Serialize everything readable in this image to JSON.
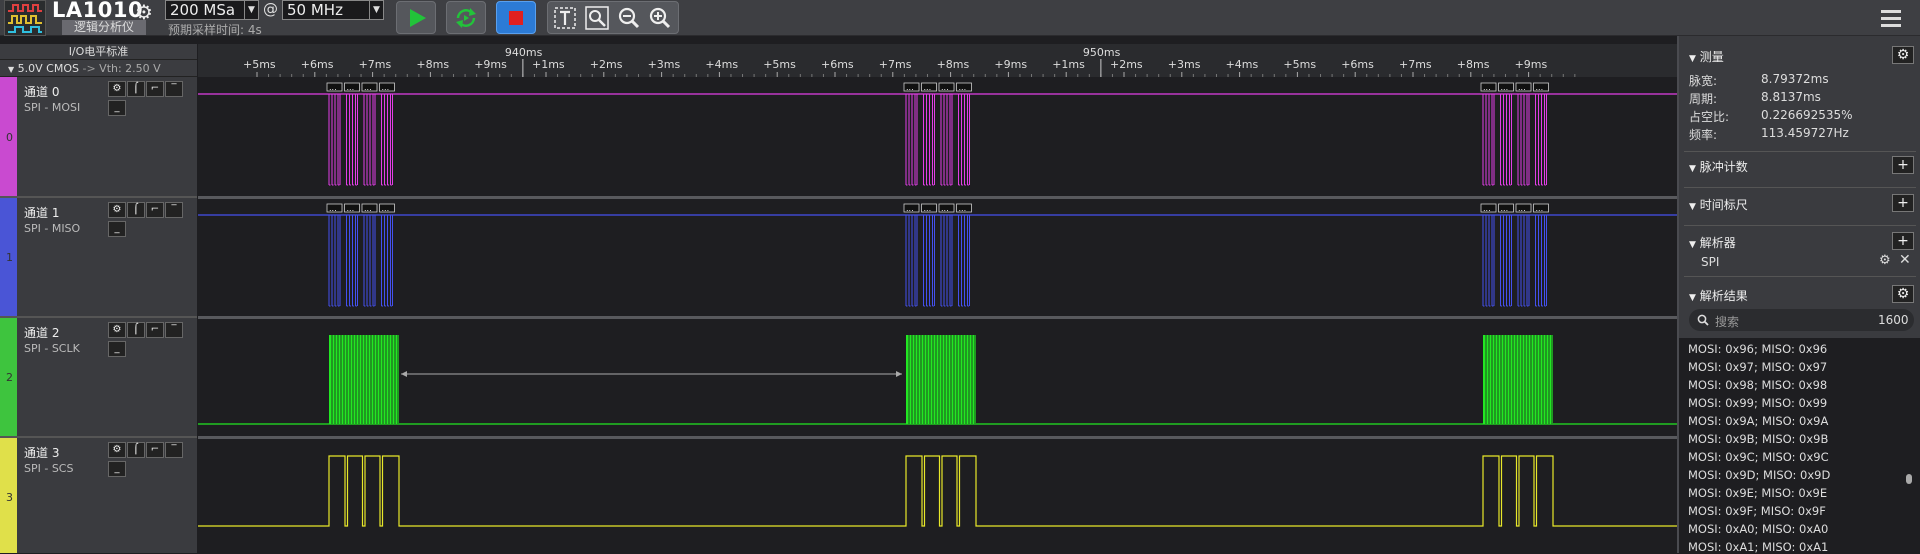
{
  "app": {
    "title": "LA1010",
    "subtitle": "逻辑分析仪",
    "sample_rate": "200 MSa",
    "at": "@",
    "frequency": "50 MHz",
    "sample_time": "预期采样时间: 4s"
  },
  "io": {
    "header": "I/O电平标准",
    "standard": "5.0V CMOS",
    "arrow": "->",
    "vth": "Vth: 2.50 V"
  },
  "channels": [
    {
      "num": "0",
      "name": "通道 0",
      "sub": "SPI - MOSI",
      "color": "#e23ee6",
      "strip": "#c94ad0"
    },
    {
      "num": "1",
      "name": "通道 1",
      "sub": "SPI - MISO",
      "color": "#4450ee",
      "strip": "#4a55d6"
    },
    {
      "num": "2",
      "name": "通道 2",
      "sub": "SPI - SCLK",
      "color": "#22e822",
      "strip": "#3ec43e"
    },
    {
      "num": "3",
      "name": "通道 3",
      "sub": "SPI - SCS",
      "color": "#e8e82a",
      "strip": "#e0e04a"
    }
  ],
  "ruler": {
    "ticks": [
      "+5ms",
      "+6ms",
      "+7ms",
      "+8ms",
      "+9ms",
      "+1ms",
      "+2ms",
      "+3ms",
      "+4ms",
      "+5ms",
      "+6ms",
      "+7ms",
      "+8ms",
      "+9ms",
      "+1ms",
      "+2ms",
      "+3ms",
      "+4ms",
      "+5ms",
      "+6ms",
      "+7ms",
      "+8ms",
      "+9ms"
    ],
    "majors": [
      "940ms",
      "950ms"
    ]
  },
  "right_panel": {
    "measure": {
      "title": "测量",
      "rows": [
        {
          "label": "脉宽:",
          "value": "8.79372ms"
        },
        {
          "label": "周期:",
          "value": "8.8137ms"
        },
        {
          "label": "占空比:",
          "value": "0.226692535%"
        },
        {
          "label": "频率:",
          "value": "113.459727Hz"
        }
      ]
    },
    "pulse_count": {
      "title": "脉冲计数"
    },
    "time_ruler": {
      "title": "时间标尺"
    },
    "analyzer": {
      "title": "解析器",
      "item": "SPI"
    },
    "results": {
      "title": "解析结果",
      "search_placeholder": "搜索",
      "count": "1600",
      "rows": [
        "MOSI: 0x96;  MISO: 0x96",
        "MOSI: 0x97;  MISO: 0x97",
        "MOSI: 0x98;  MISO: 0x98",
        "MOSI: 0x99;  MISO: 0x99",
        "MOSI: 0x9A;  MISO: 0x9A",
        "MOSI: 0x9B;  MISO: 0x9B",
        "MOSI: 0x9C;  MISO: 0x9C",
        "MOSI: 0x9D;  MISO: 0x9D",
        "MOSI: 0x9E;  MISO: 0x9E",
        "MOSI: 0x9F;  MISO: 0x9F",
        "MOSI: 0xA0;  MISO: 0xA0",
        "MOSI: 0xA1;  MISO: 0xA1"
      ]
    }
  },
  "colors": {
    "accent": "#2c7bd6",
    "run_green": "#22c33a",
    "stop_red": "#e02020"
  },
  "icons": [
    "logo-icon",
    "gear-icon",
    "play-icon",
    "loop-icon",
    "stop-icon",
    "text-tool-icon",
    "zoom-fit-icon",
    "zoom-out-icon",
    "zoom-in-icon",
    "menu-icon",
    "search-icon",
    "close-icon",
    "plus-icon",
    "rising-edge-icon",
    "falling-edge-icon",
    "high-level-icon",
    "low-level-icon"
  ]
}
